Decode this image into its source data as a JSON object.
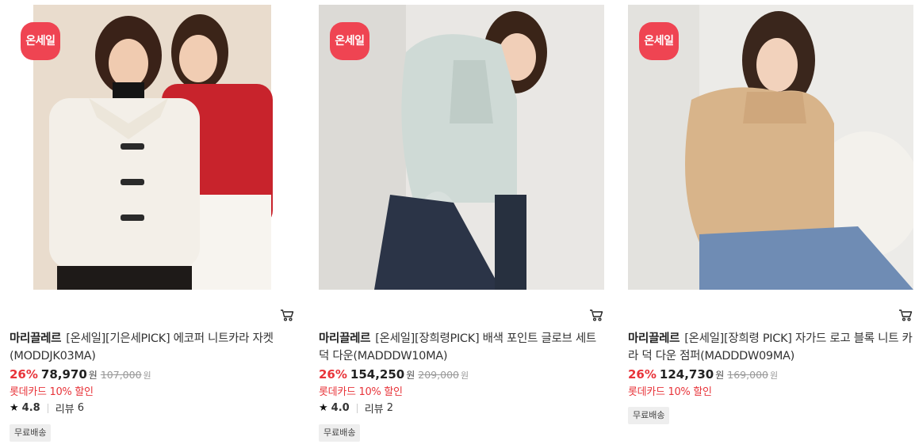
{
  "products": [
    {
      "badge": "온세일",
      "brand": "마리끌레르",
      "title": "[온세일][기은세PICK] 에코퍼 니트카라 자켓(MODDJK03MA)",
      "discount": "26%",
      "price": "78,970",
      "currency": "원",
      "original_price": "107,000",
      "promo": "롯데카드 10% 할인",
      "rating": "4.8",
      "review_label": "리뷰",
      "review_count": "6",
      "shipping_tag": "무료배송"
    },
    {
      "badge": "온세일",
      "brand": "마리끌레르",
      "title": "[온세일][장희령PICK] 배색 포인트 글로브 세트 덕 다운(MADDDW10MA)",
      "discount": "26%",
      "price": "154,250",
      "currency": "원",
      "original_price": "209,000",
      "promo": "롯데카드 10% 할인",
      "rating": "4.0",
      "review_label": "리뷰",
      "review_count": "2",
      "shipping_tag": "무료배송"
    },
    {
      "badge": "온세일",
      "brand": "마리끌레르",
      "title": "[온세일][장희령 PICK] 자가드 로고 블록 니트 카라 덕 다운 점퍼(MADDDW09MA)",
      "discount": "26%",
      "price": "124,730",
      "currency": "원",
      "original_price": "169,000",
      "promo": "롯데카드 10% 할인",
      "shipping_tag": "무료배송"
    }
  ],
  "colors": {
    "badge": "#ef4452",
    "discount": "#e8343a",
    "promo": "#e8343a"
  },
  "icons": {
    "cart": "cart-icon",
    "star": "star-icon"
  }
}
